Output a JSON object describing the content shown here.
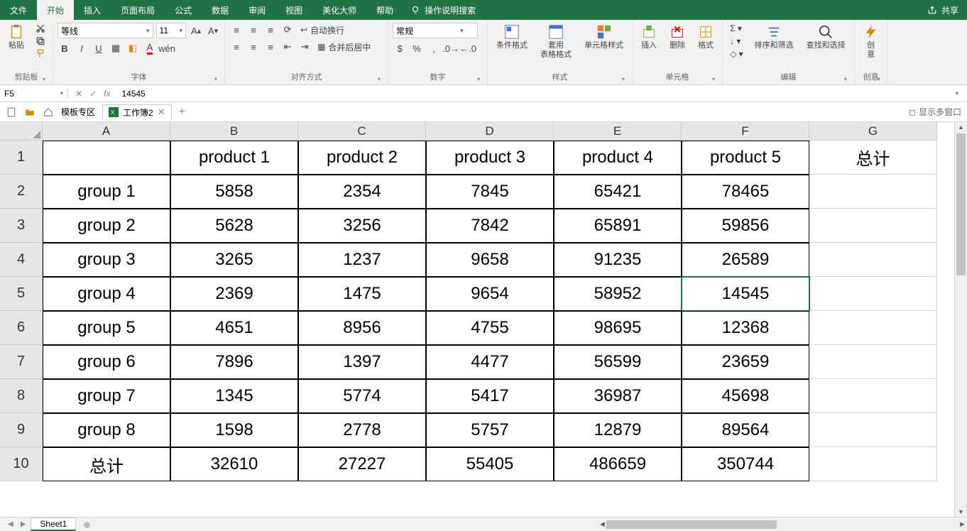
{
  "menu": {
    "items": [
      "文件",
      "开始",
      "插入",
      "页面布局",
      "公式",
      "数据",
      "审阅",
      "视图",
      "美化大师",
      "帮助"
    ],
    "active": 1,
    "search": "操作说明搜索",
    "share": "共享"
  },
  "ribbon": {
    "clipboard": {
      "paste": "粘贴",
      "label": "剪贴板"
    },
    "font": {
      "name": "等线",
      "size": "11",
      "label": "字体",
      "pinyin": "wén"
    },
    "align": {
      "wrap": "自动换行",
      "merge": "合并后居中",
      "label": "对齐方式"
    },
    "number": {
      "format": "常规",
      "label": "数字"
    },
    "styles": {
      "cond": "条件格式",
      "table": "套用\n表格格式",
      "cell": "单元格样式",
      "label": "样式"
    },
    "cells": {
      "insert": "插入",
      "delete": "删除",
      "format": "格式",
      "label": "单元格"
    },
    "editing": {
      "sort": "排序和筛选",
      "find": "查找和选择",
      "label": "编辑"
    },
    "idea": {
      "idea": "创\n意",
      "label": "创意"
    }
  },
  "formula": {
    "cellref": "F5",
    "value": "14545"
  },
  "tabs": {
    "template": "模板专区",
    "workbook": "工作簿2",
    "multiwindow": "显示多窗口"
  },
  "grid": {
    "cols": [
      "A",
      "B",
      "C",
      "D",
      "E",
      "F",
      "G"
    ],
    "rownums": [
      "1",
      "2",
      "3",
      "4",
      "5",
      "6",
      "7",
      "8",
      "9",
      "10"
    ],
    "data": [
      [
        "",
        "product 1",
        "product 2",
        "product 3",
        "product 4",
        "product 5",
        "总计"
      ],
      [
        "group 1",
        "5858",
        "2354",
        "7845",
        "65421",
        "78465",
        ""
      ],
      [
        "group 2",
        "5628",
        "3256",
        "7842",
        "65891",
        "59856",
        ""
      ],
      [
        "group 3",
        "3265",
        "1237",
        "9658",
        "91235",
        "26589",
        ""
      ],
      [
        "group 4",
        "2369",
        "1475",
        "9654",
        "58952",
        "14545",
        ""
      ],
      [
        "group 5",
        "4651",
        "8956",
        "4755",
        "98695",
        "12368",
        ""
      ],
      [
        "group 6",
        "7896",
        "1397",
        "4477",
        "56599",
        "23659",
        ""
      ],
      [
        "group 7",
        "1345",
        "5774",
        "5417",
        "36987",
        "45698",
        ""
      ],
      [
        "group 8",
        "1598",
        "2778",
        "5757",
        "12879",
        "89564",
        ""
      ],
      [
        "总计",
        "32610",
        "27227",
        "55405",
        "486659",
        "350744",
        ""
      ]
    ],
    "selected": {
      "row": 4,
      "col": 5
    }
  },
  "sheet": {
    "name": "Sheet1"
  }
}
